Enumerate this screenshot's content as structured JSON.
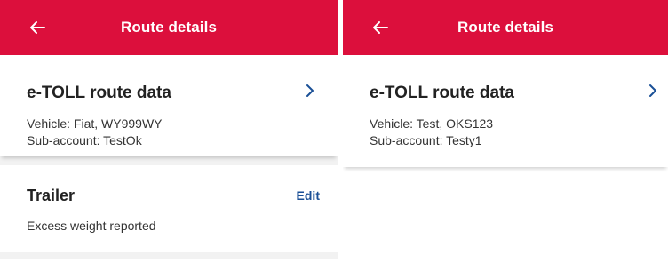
{
  "colors": {
    "accent": "#dc0f3c",
    "link": "#1a4f96"
  },
  "screens": [
    {
      "header": {
        "title": "Route details",
        "back_icon": "arrow-left-icon"
      },
      "route_card": {
        "title": "e-TOLL route data",
        "vehicle": "Vehicle: Fiat, WY999WY",
        "subaccount": "Sub-account: TestOk",
        "chevron_icon": "chevron-right-icon"
      },
      "trailer_card": {
        "title": "Trailer",
        "edit_label": "Edit",
        "status": "Excess weight reported"
      }
    },
    {
      "header": {
        "title": "Route details",
        "back_icon": "arrow-left-icon"
      },
      "route_card": {
        "title": "e-TOLL route data",
        "vehicle": "Vehicle: Test, OKS123",
        "subaccount": "Sub-account: Testy1",
        "chevron_icon": "chevron-right-icon"
      }
    }
  ]
}
